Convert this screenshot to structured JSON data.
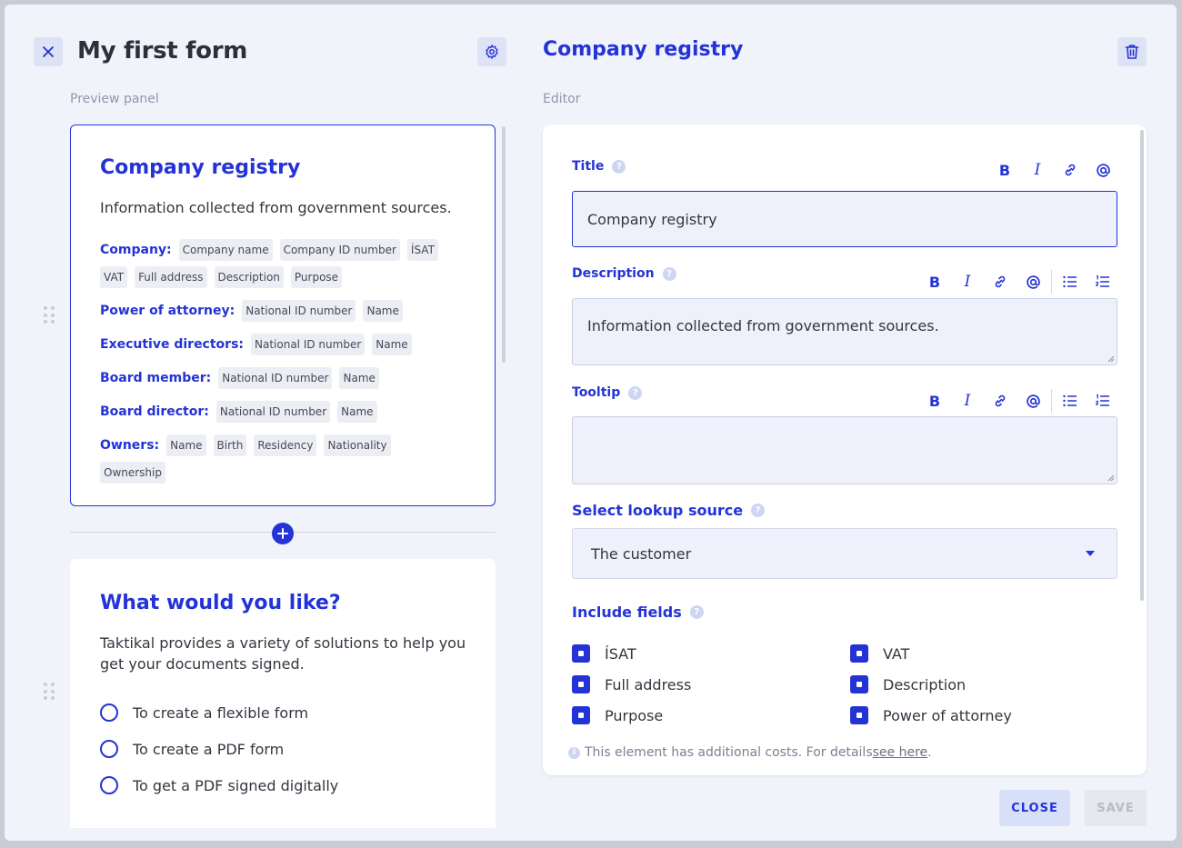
{
  "header": {
    "form_title": "My first form",
    "editor_title": "Company registry",
    "close_icon": "close-icon",
    "settings_icon": "gear-icon",
    "delete_icon": "trash-icon"
  },
  "labels": {
    "preview_panel": "Preview panel",
    "editor": "Editor"
  },
  "preview": {
    "card1": {
      "title": "Company registry",
      "description": "Information collected from government sources.",
      "rows": [
        {
          "label": "Company:",
          "tags": [
            "Company name",
            "Company ID number",
            "ÍSAT",
            "VAT",
            "Full address",
            "Description",
            "Purpose"
          ]
        },
        {
          "label": "Power of attorney:",
          "tags": [
            "National ID number",
            "Name"
          ]
        },
        {
          "label": "Executive directors:",
          "tags": [
            "National ID number",
            "Name"
          ]
        },
        {
          "label": "Board member:",
          "tags": [
            "National ID number",
            "Name"
          ]
        },
        {
          "label": "Board director:",
          "tags": [
            "National ID number",
            "Name"
          ]
        },
        {
          "label": "Owners:",
          "tags": [
            "Name",
            "Birth",
            "Residency",
            "Nationality",
            "Ownership"
          ]
        }
      ]
    },
    "card2": {
      "title": "What would you like?",
      "description": "Taktikal provides a variety of solutions to help you get your documents signed.",
      "options": [
        "To create a flexible form",
        "To create a PDF form",
        "To get a PDF signed digitally"
      ]
    }
  },
  "editor": {
    "title_label": "Title",
    "title_value": "Company registry",
    "description_label": "Description",
    "description_value": "Information collected from government sources.",
    "tooltip_label": "Tooltip",
    "tooltip_value": "",
    "toolbar": {
      "bold": "B",
      "italic": "I"
    },
    "lookup_label": "Select lookup source",
    "lookup_value": "The customer",
    "include_label": "Include fields",
    "fields": [
      "ÍSAT",
      "VAT",
      "Full address",
      "Description",
      "Purpose",
      "Power of attorney"
    ],
    "note_text": "This element has additional costs. For details ",
    "note_link": "see here",
    "note_end": "."
  },
  "footer": {
    "close_label": "CLOSE",
    "save_label": "SAVE"
  },
  "colors": {
    "accent": "#2433d6",
    "background": "#f1f3fa"
  }
}
